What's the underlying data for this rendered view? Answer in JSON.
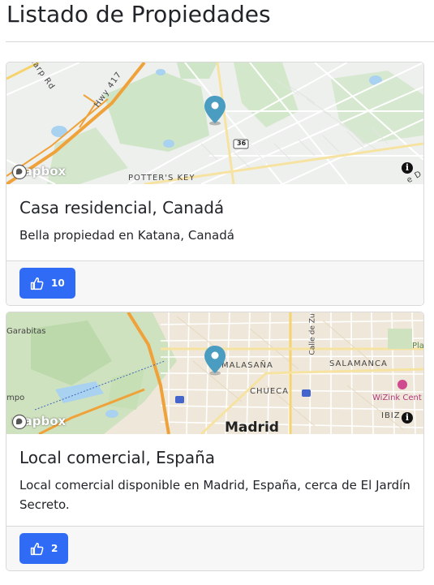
{
  "page": {
    "title": "Listado de Propiedades"
  },
  "properties": [
    {
      "title": "Casa residencial, Canadá",
      "description": "Bella propiedad en Katana, Canadá",
      "likes": "10",
      "map": {
        "logo_text": "mapbox",
        "info_label": "i",
        "labels": [
          "Carp Rd",
          "Hwy 417",
          "POTTER'S KEY",
          "36",
          "e D"
        ]
      }
    },
    {
      "title": "Local comercial, España",
      "description": "Local comercial disponible en Madrid, España, cerca de El Jardín Secreto.",
      "likes": "2",
      "map": {
        "logo_text": "mapbox",
        "info_label": "i",
        "labels": [
          "Garabitas",
          "MALASAÑA",
          "SALAMANCA",
          "CHUECA",
          "Madrid",
          "WiZink Cent",
          "Calle de Zu",
          "Pla de",
          "IBIZ",
          "mpo"
        ]
      }
    }
  ],
  "colors": {
    "accent": "#2f6bf5",
    "pin": "#4a9cc0",
    "map_canada_bg": "#eef0ee",
    "map_madrid_bg": "#efe7d9"
  }
}
